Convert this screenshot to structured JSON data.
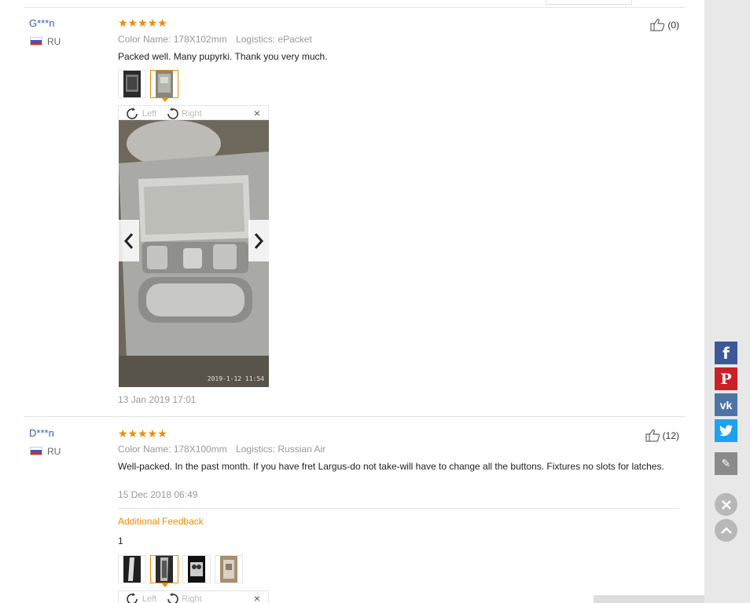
{
  "reviews": [
    {
      "user": "G***n",
      "country": "RU",
      "stars": "★★★★★",
      "color_name": "Color Name: 178X102mm",
      "logistics": "Logistics: ePacket",
      "text": "Packed well. Many pupyrki. Thank you very much.",
      "helpful": "(0)",
      "date": "13 Jan 2019 17:01",
      "viewer": {
        "left_label": "Left",
        "right_label": "Right",
        "close": "×",
        "photo_stamp": "2019-1-12 11:54"
      }
    },
    {
      "user": "D***n",
      "country": "RU",
      "stars": "★★★★★",
      "color_name": "Color Name: 178X100mm",
      "logistics": "Logistics: Russian Air",
      "text": "Well-packed. In the past month. If you have fret Largus-do not take-will have to change all the buttons. Fixtures no slots for latches.",
      "helpful": "(12)",
      "date": "15 Dec 2018 06:49",
      "additional_feedback_title": "Additional Feedback",
      "additional_feedback_text": "1",
      "viewer": {
        "left_label": "Left",
        "right_label": "Right",
        "close": "×"
      }
    }
  ],
  "social": [
    {
      "name": "facebook-icon",
      "glyph": "f",
      "color": "#3b5998"
    },
    {
      "name": "pinterest-icon",
      "glyph": "P",
      "color": "#cb2027"
    },
    {
      "name": "vk-icon",
      "glyph": "vk",
      "color": "#4c75a3"
    },
    {
      "name": "twitter-icon",
      "glyph": "t",
      "color": "#1da1f2"
    },
    {
      "name": "edit-icon",
      "glyph": "✎",
      "color": "#8a8a8a"
    }
  ],
  "colors": {
    "accent": "#f08c00",
    "link": "#3366aa",
    "muted": "#999999"
  }
}
